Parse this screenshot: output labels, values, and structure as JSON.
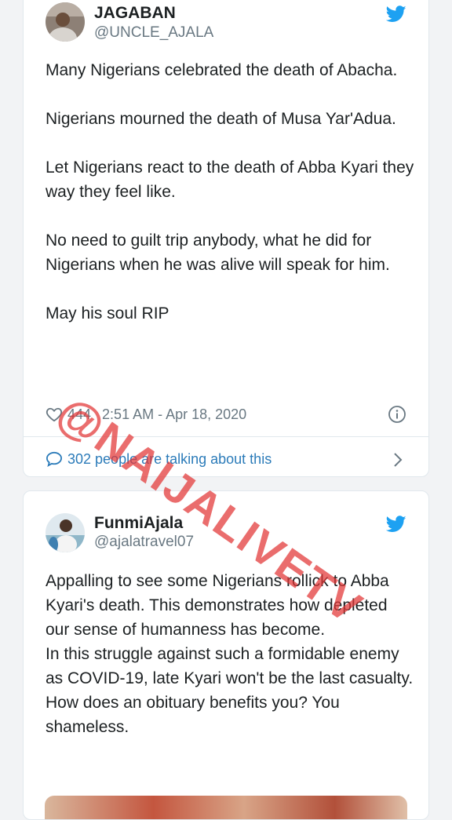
{
  "tweets": [
    {
      "display_name": "JAGABAN",
      "handle": "@UNCLE_AJALA",
      "paragraphs": [
        "Many Nigerians celebrated the death of Abacha.",
        "Nigerians mourned the death of Musa Yar'Adua.",
        "Let Nigerians react to the death of Abba Kyari they way they feel like.",
        "No need to guilt trip anybody, what he did for Nigerians when he was alive will speak for him.",
        "May his soul RIP"
      ],
      "like_count": "444",
      "timestamp": "2:51 AM - Apr 18, 2020",
      "talking_text": "302 people are talking about this"
    },
    {
      "display_name": "FunmiAjala",
      "handle": "@ajalatravel07",
      "lines": [
        "Appalling to see some Nigerians rollick to Abba Kyari's death. This demonstrates how depleted our sense of humanness has become.",
        "In this struggle against such a formidable enemy as COVID-19, late Kyari won't be the last casualty.",
        "How does an obituary benefits you? You shameless."
      ]
    }
  ],
  "watermark": "@NAIJALIVETV",
  "colors": {
    "twitter_blue": "#1da1f2",
    "link_blue": "#2b7bb9",
    "watermark_red": "#e23434"
  }
}
